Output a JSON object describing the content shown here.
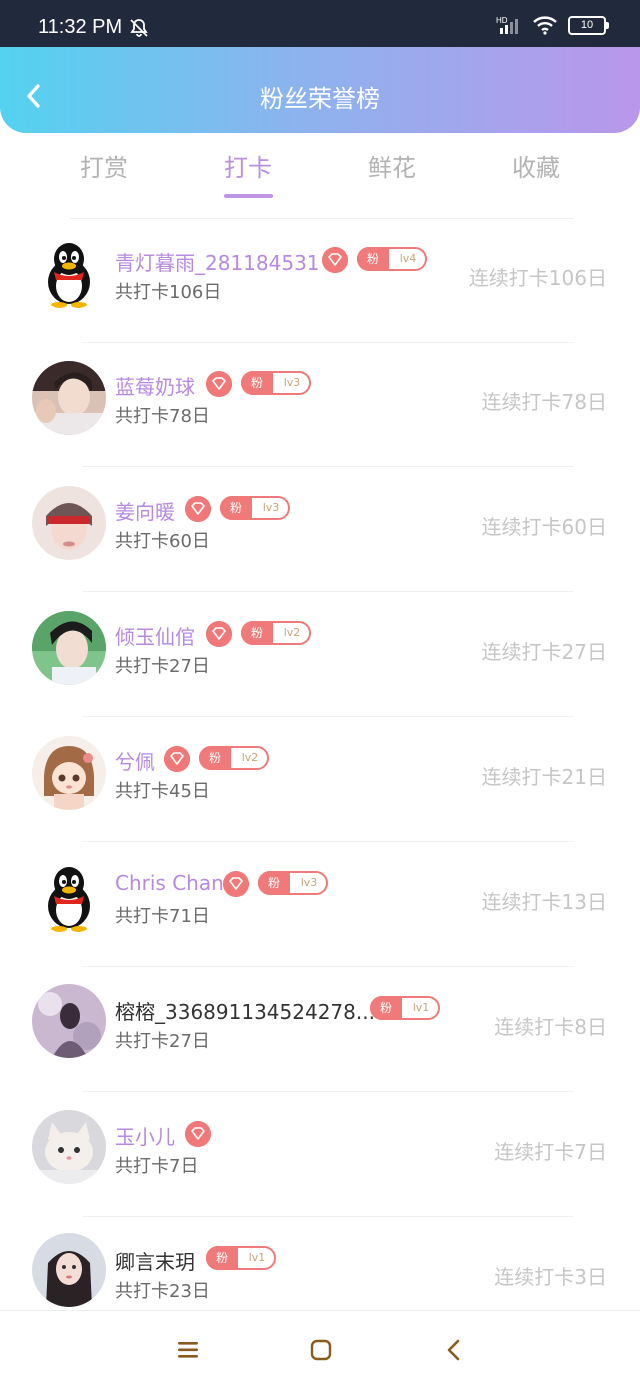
{
  "status_bar": {
    "time": "11:32 PM",
    "battery": "10",
    "network": "HD"
  },
  "header": {
    "title": "粉丝荣誉榜"
  },
  "tabs": [
    {
      "label": "打赏",
      "active": false
    },
    {
      "label": "打卡",
      "active": true
    },
    {
      "label": "鲜花",
      "active": false
    },
    {
      "label": "收藏",
      "active": false
    }
  ],
  "fan_badge_label": "粉",
  "rows": [
    {
      "name": "青灯暮雨_281184531",
      "total": "共打卡106日",
      "streak": "连续打卡106日",
      "level": "lv4",
      "vip": true,
      "avatar": "penguin-avatar"
    },
    {
      "name": "蓝莓奶球",
      "total": "共打卡78日",
      "streak": "连续打卡78日",
      "level": "lv3",
      "vip": true,
      "avatar": "photo-avatar"
    },
    {
      "name": "姜向暖",
      "total": "共打卡60日",
      "streak": "连续打卡60日",
      "level": "lv3",
      "vip": true,
      "avatar": "photo-avatar"
    },
    {
      "name": "倾玉仙倌",
      "total": "共打卡27日",
      "streak": "连续打卡27日",
      "level": "lv2",
      "vip": true,
      "avatar": "photo-avatar"
    },
    {
      "name": "兮佩",
      "total": "共打卡45日",
      "streak": "连续打卡21日",
      "level": "lv2",
      "vip": true,
      "avatar": "anime-avatar"
    },
    {
      "name": "Chris Chan",
      "total": "共打卡71日",
      "streak": "连续打卡13日",
      "level": "lv3",
      "vip": true,
      "avatar": "penguin-avatar"
    },
    {
      "name": "榕榕_336891134524278...",
      "total": "共打卡27日",
      "streak": "连续打卡8日",
      "level": "lv1",
      "vip": false,
      "avatar": "photo-avatar"
    },
    {
      "name": "玉小儿",
      "total": "共打卡7日",
      "streak": "连续打卡7日",
      "level": "",
      "vip": true,
      "avatar": "cat-avatar"
    },
    {
      "name": "卿言末玥",
      "total": "共打卡23日",
      "streak": "连续打卡3日",
      "level": "lv1",
      "vip": false,
      "avatar": "photo-avatar"
    }
  ],
  "colors": {
    "accent": "#b58adf",
    "badge": "#f07878",
    "header_start": "#54d2f0",
    "header_end": "#b997ea"
  }
}
